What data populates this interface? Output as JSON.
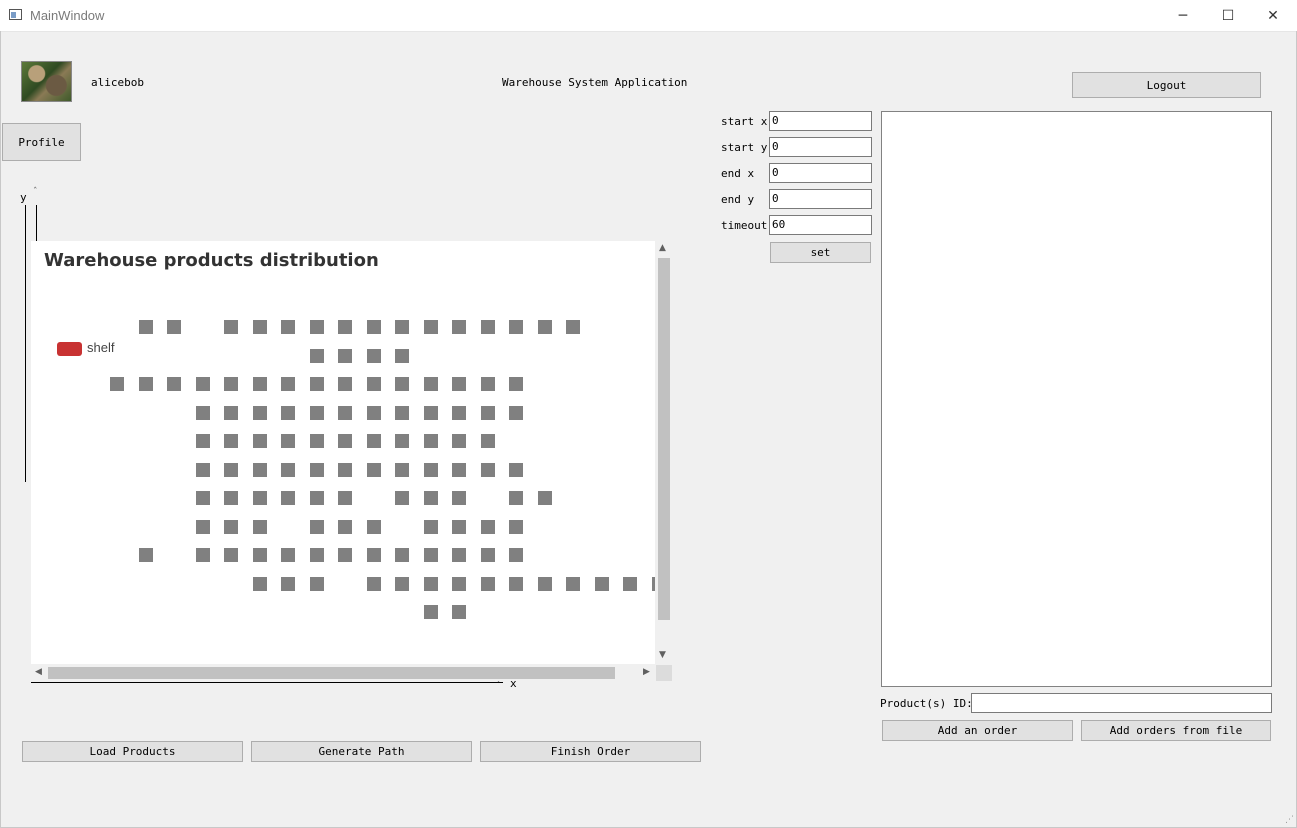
{
  "window": {
    "title": "MainWindow",
    "minimize": "─",
    "maximize": "☐",
    "close": "✕"
  },
  "header": {
    "username": "alicebob",
    "app_title": "Warehouse System Application",
    "logout_label": "Logout",
    "profile_label": "Profile"
  },
  "axes": {
    "y_label": "y",
    "x_label": "x"
  },
  "chart_data": {
    "type": "heatmap",
    "title": "Warehouse products distribution",
    "legend": [
      {
        "name": "shelf",
        "color": "#c83232"
      }
    ],
    "shelves": [
      [
        3,
        0
      ],
      [
        4,
        0
      ],
      [
        6,
        0
      ],
      [
        7,
        0
      ],
      [
        8,
        0
      ],
      [
        9,
        0
      ],
      [
        10,
        0
      ],
      [
        11,
        0
      ],
      [
        12,
        0
      ],
      [
        13,
        0
      ],
      [
        14,
        0
      ],
      [
        15,
        0
      ],
      [
        16,
        0
      ],
      [
        17,
        0
      ],
      [
        18,
        0
      ],
      [
        9,
        1
      ],
      [
        10,
        1
      ],
      [
        11,
        1
      ],
      [
        12,
        1
      ],
      [
        2,
        2
      ],
      [
        3,
        2
      ],
      [
        4,
        2
      ],
      [
        5,
        2
      ],
      [
        6,
        2
      ],
      [
        7,
        2
      ],
      [
        8,
        2
      ],
      [
        9,
        2
      ],
      [
        10,
        2
      ],
      [
        11,
        2
      ],
      [
        12,
        2
      ],
      [
        13,
        2
      ],
      [
        14,
        2
      ],
      [
        15,
        2
      ],
      [
        16,
        2
      ],
      [
        5,
        3
      ],
      [
        6,
        3
      ],
      [
        7,
        3
      ],
      [
        8,
        3
      ],
      [
        9,
        3
      ],
      [
        10,
        3
      ],
      [
        11,
        3
      ],
      [
        12,
        3
      ],
      [
        13,
        3
      ],
      [
        14,
        3
      ],
      [
        15,
        3
      ],
      [
        16,
        3
      ],
      [
        5,
        4
      ],
      [
        6,
        4
      ],
      [
        7,
        4
      ],
      [
        8,
        4
      ],
      [
        9,
        4
      ],
      [
        10,
        4
      ],
      [
        11,
        4
      ],
      [
        12,
        4
      ],
      [
        13,
        4
      ],
      [
        14,
        4
      ],
      [
        15,
        4
      ],
      [
        5,
        5
      ],
      [
        6,
        5
      ],
      [
        7,
        5
      ],
      [
        8,
        5
      ],
      [
        9,
        5
      ],
      [
        10,
        5
      ],
      [
        11,
        5
      ],
      [
        12,
        5
      ],
      [
        13,
        5
      ],
      [
        14,
        5
      ],
      [
        15,
        5
      ],
      [
        16,
        5
      ],
      [
        5,
        6
      ],
      [
        6,
        6
      ],
      [
        7,
        6
      ],
      [
        8,
        6
      ],
      [
        9,
        6
      ],
      [
        10,
        6
      ],
      [
        12,
        6
      ],
      [
        13,
        6
      ],
      [
        14,
        6
      ],
      [
        16,
        6
      ],
      [
        17,
        6
      ],
      [
        5,
        7
      ],
      [
        6,
        7
      ],
      [
        7,
        7
      ],
      [
        9,
        7
      ],
      [
        10,
        7
      ],
      [
        11,
        7
      ],
      [
        13,
        7
      ],
      [
        14,
        7
      ],
      [
        15,
        7
      ],
      [
        16,
        7
      ],
      [
        3,
        8
      ],
      [
        5,
        8
      ],
      [
        6,
        8
      ],
      [
        7,
        8
      ],
      [
        8,
        8
      ],
      [
        9,
        8
      ],
      [
        10,
        8
      ],
      [
        11,
        8
      ],
      [
        12,
        8
      ],
      [
        13,
        8
      ],
      [
        14,
        8
      ],
      [
        15,
        8
      ],
      [
        16,
        8
      ],
      [
        7,
        9
      ],
      [
        8,
        9
      ],
      [
        9,
        9
      ],
      [
        11,
        9
      ],
      [
        12,
        9
      ],
      [
        13,
        9
      ],
      [
        14,
        9
      ],
      [
        15,
        9
      ],
      [
        16,
        9
      ],
      [
        17,
        9
      ],
      [
        18,
        9
      ],
      [
        19,
        9
      ],
      [
        20,
        9
      ],
      [
        21,
        9
      ],
      [
        13,
        10
      ],
      [
        14,
        10
      ]
    ]
  },
  "params": {
    "start_x": {
      "label": "start x",
      "value": "0"
    },
    "start_y": {
      "label": "start y",
      "value": "0"
    },
    "end_x": {
      "label": "end x",
      "value": "0"
    },
    "end_y": {
      "label": "end y",
      "value": "0"
    },
    "timeout": {
      "label": "timeout",
      "value": "60"
    },
    "set_label": "set"
  },
  "orders": {
    "product_ids_label": "Product(s) ID:",
    "product_ids_value": "",
    "add_order_label": "Add an order",
    "add_from_file_label": "Add orders from file"
  },
  "footer": {
    "load_products_label": "Load Products",
    "generate_path_label": "Generate Path",
    "finish_order_label": "Finish Order"
  }
}
